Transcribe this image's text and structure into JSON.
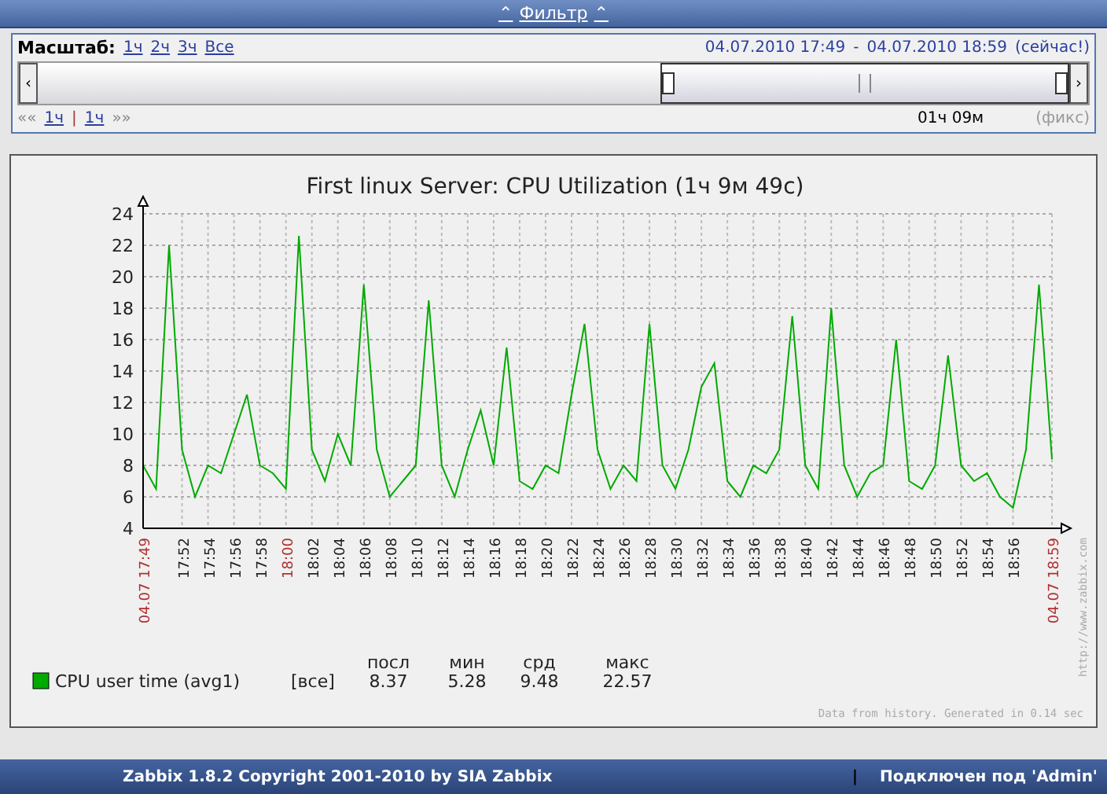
{
  "filter_bar": {
    "left_icon": "⌃",
    "label": "Фильтр",
    "right_icon": "⌃"
  },
  "filter": {
    "scale_label": "Масштаб:",
    "scale_links": [
      "1ч",
      "2ч",
      "3ч",
      "Все"
    ],
    "date_from": "04.07.2010 17:49",
    "dash": "-",
    "date_to": "04.07.2010 18:59",
    "now_label": "(сейчас!)",
    "scroll_left": "‹",
    "scroll_right": "›",
    "nav_back": "««",
    "step_back": "1ч",
    "separator": "|",
    "step_forward": "1ч",
    "nav_forward": "»»",
    "period": "01ч 09м",
    "fixed": "(фикс)"
  },
  "graph": {
    "title": "First linux Server: CPU Utilization  (1ч 9м 49с)",
    "side_note": "http://www.zabbix.com",
    "footer_note": "Data from history. Generated in 0.14 sec",
    "axis_labels": [
      {
        "highlighted": true
      },
      {
        "highlighted": false
      },
      {
        "highlighted": false
      },
      {
        "highlighted": false
      },
      {
        "highlighted": false
      },
      {
        "highlighted": true
      },
      {
        "highlighted": false
      },
      {
        "highlighted": false
      },
      {
        "highlighted": false
      },
      {
        "highlighted": false
      },
      {
        "highlighted": false
      },
      {
        "highlighted": false
      },
      {
        "highlighted": false
      },
      {
        "highlighted": false
      },
      {
        "highlighted": false
      },
      {
        "highlighted": false
      },
      {
        "highlighted": false
      },
      {
        "highlighted": false
      },
      {
        "highlighted": false
      },
      {
        "highlighted": false
      },
      {
        "highlighted": false
      },
      {
        "highlighted": false
      },
      {
        "highlighted": false
      },
      {
        "highlighted": false
      },
      {
        "highlighted": false
      },
      {
        "highlighted": false
      },
      {
        "highlighted": false
      },
      {
        "highlighted": false
      },
      {
        "highlighted": false
      },
      {
        "highlighted": false
      },
      {
        "highlighted": false
      },
      {
        "highlighted": false
      },
      {
        "highlighted": false
      },
      {
        "highlighted": false
      },
      {
        "highlighted": true
      }
    ],
    "chart_data": {
      "type": "line",
      "grid": true,
      "ylim": [
        4,
        24
      ],
      "yticks": [
        4,
        6,
        8,
        10,
        12,
        14,
        16,
        18,
        20,
        22,
        24
      ],
      "categories": [
        "04.07 17:49",
        null,
        null,
        "17:52",
        null,
        "17:54",
        null,
        "17:56",
        null,
        "17:58",
        null,
        "18:00",
        null,
        "18:02",
        null,
        "18:04",
        null,
        "18:06",
        null,
        "18:08",
        null,
        "18:10",
        null,
        "18:12",
        null,
        "18:14",
        null,
        "18:16",
        null,
        "18:18",
        null,
        "18:20",
        null,
        "18:22",
        null,
        "18:24",
        null,
        "18:26",
        null,
        "18:28",
        null,
        "18:30",
        null,
        "18:32",
        null,
        "18:34",
        null,
        "18:36",
        null,
        "18:38",
        null,
        "18:40",
        null,
        "18:42",
        null,
        "18:44",
        null,
        "18:46",
        null,
        "18:48",
        null,
        "18:50",
        null,
        "18:52",
        null,
        "18:54",
        null,
        "18:56",
        null,
        null,
        "04.07 18:59"
      ],
      "series": [
        {
          "name": "CPU user time (avg1)",
          "color": "#00aa00",
          "values": [
            8,
            6.5,
            22,
            9,
            6,
            8,
            7.5,
            10,
            12.5,
            8,
            7.5,
            6.5,
            22.6,
            9,
            7,
            10,
            8,
            19.5,
            9,
            6,
            7,
            8,
            18.5,
            8,
            6,
            9,
            11.5,
            8,
            15.5,
            7,
            6.5,
            8,
            7.5,
            12.5,
            17,
            9,
            6.5,
            8,
            7,
            17,
            8,
            6.5,
            9,
            13,
            14.5,
            7,
            6,
            8,
            7.5,
            9,
            17.5,
            8,
            6.5,
            18,
            8,
            6,
            7.5,
            8,
            16,
            7,
            6.5,
            8,
            15,
            8,
            7,
            7.5,
            6,
            5.3,
            9,
            19.5,
            8.4
          ]
        }
      ]
    },
    "legend": {
      "headers": [
        "посл",
        "мин",
        "срд",
        "макс"
      ],
      "items": [
        {
          "scope": "[все]",
          "values": [
            "8.37",
            "5.28",
            "9.48",
            "22.57"
          ]
        }
      ]
    }
  },
  "footer": {
    "copyright": "Zabbix 1.8.2 Copyright 2001-2010 by SIA Zabbix",
    "separator": "|",
    "user": "Подключен под 'Admin'"
  }
}
